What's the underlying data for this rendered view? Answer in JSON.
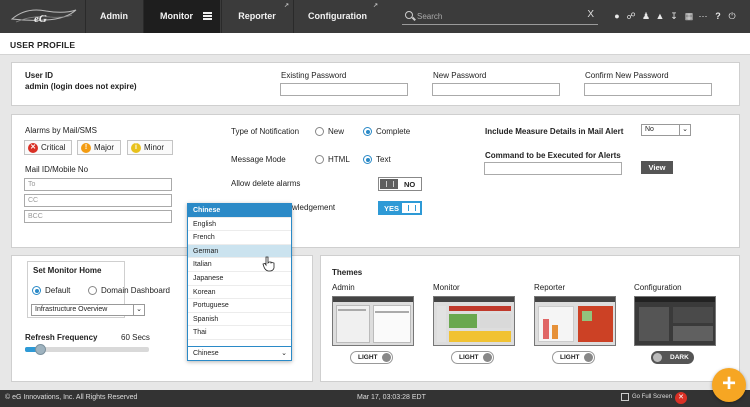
{
  "header": {
    "logo_text": "eG",
    "tabs": [
      {
        "label": "Admin"
      },
      {
        "label": "Monitor"
      },
      {
        "label": "Reporter"
      },
      {
        "label": "Configuration"
      }
    ],
    "search": {
      "placeholder": "Search",
      "clear": "X"
    },
    "icons": [
      "user-icon",
      "link-icon",
      "people-icon",
      "bell-icon",
      "download-icon",
      "network-icon",
      "more-icon",
      "help-icon",
      "power-icon"
    ]
  },
  "page": {
    "title": "USER PROFILE"
  },
  "account": {
    "user_id_label": "User ID",
    "user_id_value": "admin (login does not expire)",
    "existing_password_label": "Existing Password",
    "new_password_label": "New Password",
    "confirm_password_label": "Confirm New Password"
  },
  "alarms": {
    "title": "Alarms by Mail/SMS",
    "buttons": [
      {
        "label": "Critical",
        "icon": "critical-icon",
        "color": "#d93025"
      },
      {
        "label": "Major",
        "icon": "major-icon",
        "color": "#f39c12"
      },
      {
        "label": "Minor",
        "icon": "minor-icon",
        "color": "#e8c11c"
      }
    ],
    "mail_label": "Mail ID/Mobile No",
    "to_placeholder": "To",
    "cc_placeholder": "CC",
    "bcc_placeholder": "BCC"
  },
  "notification": {
    "type_label": "Type of Notification",
    "type_options": [
      "New",
      "Complete"
    ],
    "message_mode_label": "Message Mode",
    "message_mode_options": [
      "HTML",
      "Text"
    ],
    "allow_delete_label": "Allow delete alarms",
    "allow_delete_value": "NO",
    "ack_label": "wledgement",
    "ack_value": "YES"
  },
  "mail_alert": {
    "measure_label": "Include Measure Details in Mail Alert",
    "measure_value": "No",
    "command_label": "Command to be Executed for Alerts",
    "view_button": "View"
  },
  "language_dropdown": {
    "header": "Chinese",
    "options": [
      "English",
      "French",
      "German",
      "Italian",
      "Japanese",
      "Korean",
      "Portuguese",
      "Spanish",
      "Thai"
    ],
    "selected": "Chinese"
  },
  "monitor_home": {
    "title": "Set Monitor Home",
    "options": [
      "Default",
      "Domain Dashboard"
    ],
    "select_value": "Infrastructure Overview",
    "refresh_label": "Refresh Frequency",
    "refresh_value": "60 Secs",
    "refresh_level": 0.12
  },
  "themes": {
    "title": "Themes",
    "items": [
      {
        "name": "Admin",
        "state": "LIGHT"
      },
      {
        "name": "Monitor",
        "state": "LIGHT"
      },
      {
        "name": "Reporter",
        "state": "LIGHT"
      },
      {
        "name": "Configuration",
        "state": "DARK"
      }
    ]
  },
  "footer": {
    "copyright": "© eG Innovations, Inc. All Rights Reserved",
    "datetime": "Mar 17, 03:03:28 EDT",
    "fullscreen": "Go Full Screen"
  },
  "fab": {
    "label": "+"
  }
}
